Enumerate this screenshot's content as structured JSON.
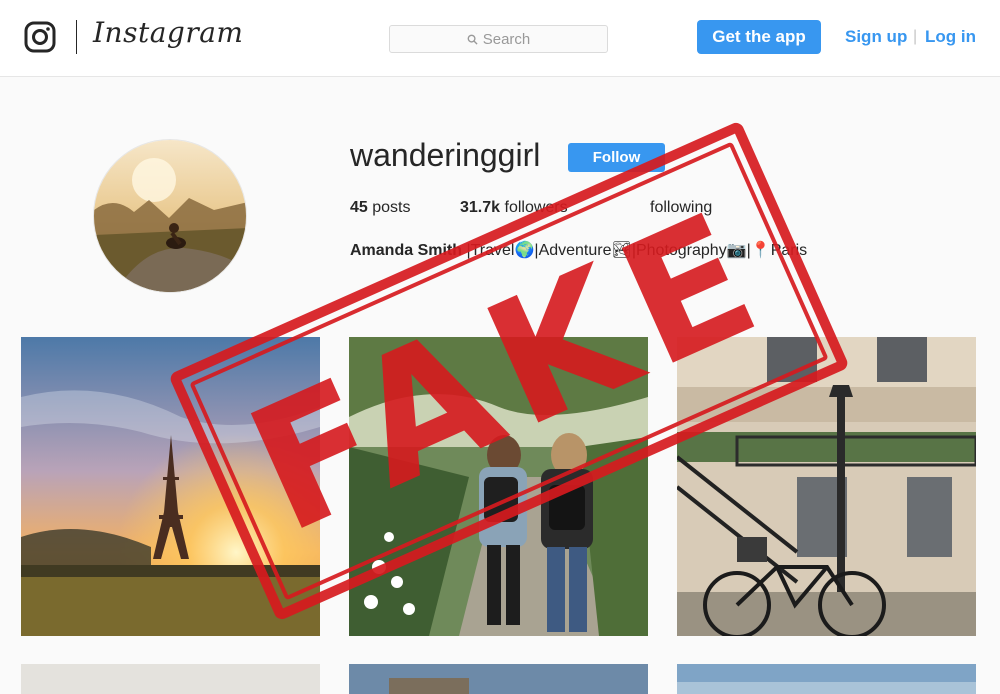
{
  "header": {
    "brand": "Instagram",
    "search_placeholder": "Search",
    "get_app_label": "Get the app",
    "signup_label": "Sign up",
    "separator": "|",
    "login_label": "Log in"
  },
  "profile": {
    "username": "wanderinggirl",
    "follow_label": "Follow",
    "posts_count": "45",
    "posts_label": "posts",
    "followers_count": "31.7k",
    "followers_label": "followers",
    "following_label": "following",
    "full_name": "Amanda Smith",
    "bio": "|Travel🌍|Adventure🏞|Photography📷|📍Paris"
  },
  "stamp": {
    "text": "FAKE",
    "color": "#d61a1e"
  },
  "colors": {
    "accent": "#3897f0",
    "text": "#262626",
    "background": "#fafafa"
  },
  "posts": [
    {
      "name": "post-eiffel-tower"
    },
    {
      "name": "post-two-girls-walking"
    },
    {
      "name": "post-paris-bicycle"
    },
    {
      "name": "post-row2-1"
    },
    {
      "name": "post-row2-2"
    },
    {
      "name": "post-row2-3"
    }
  ]
}
